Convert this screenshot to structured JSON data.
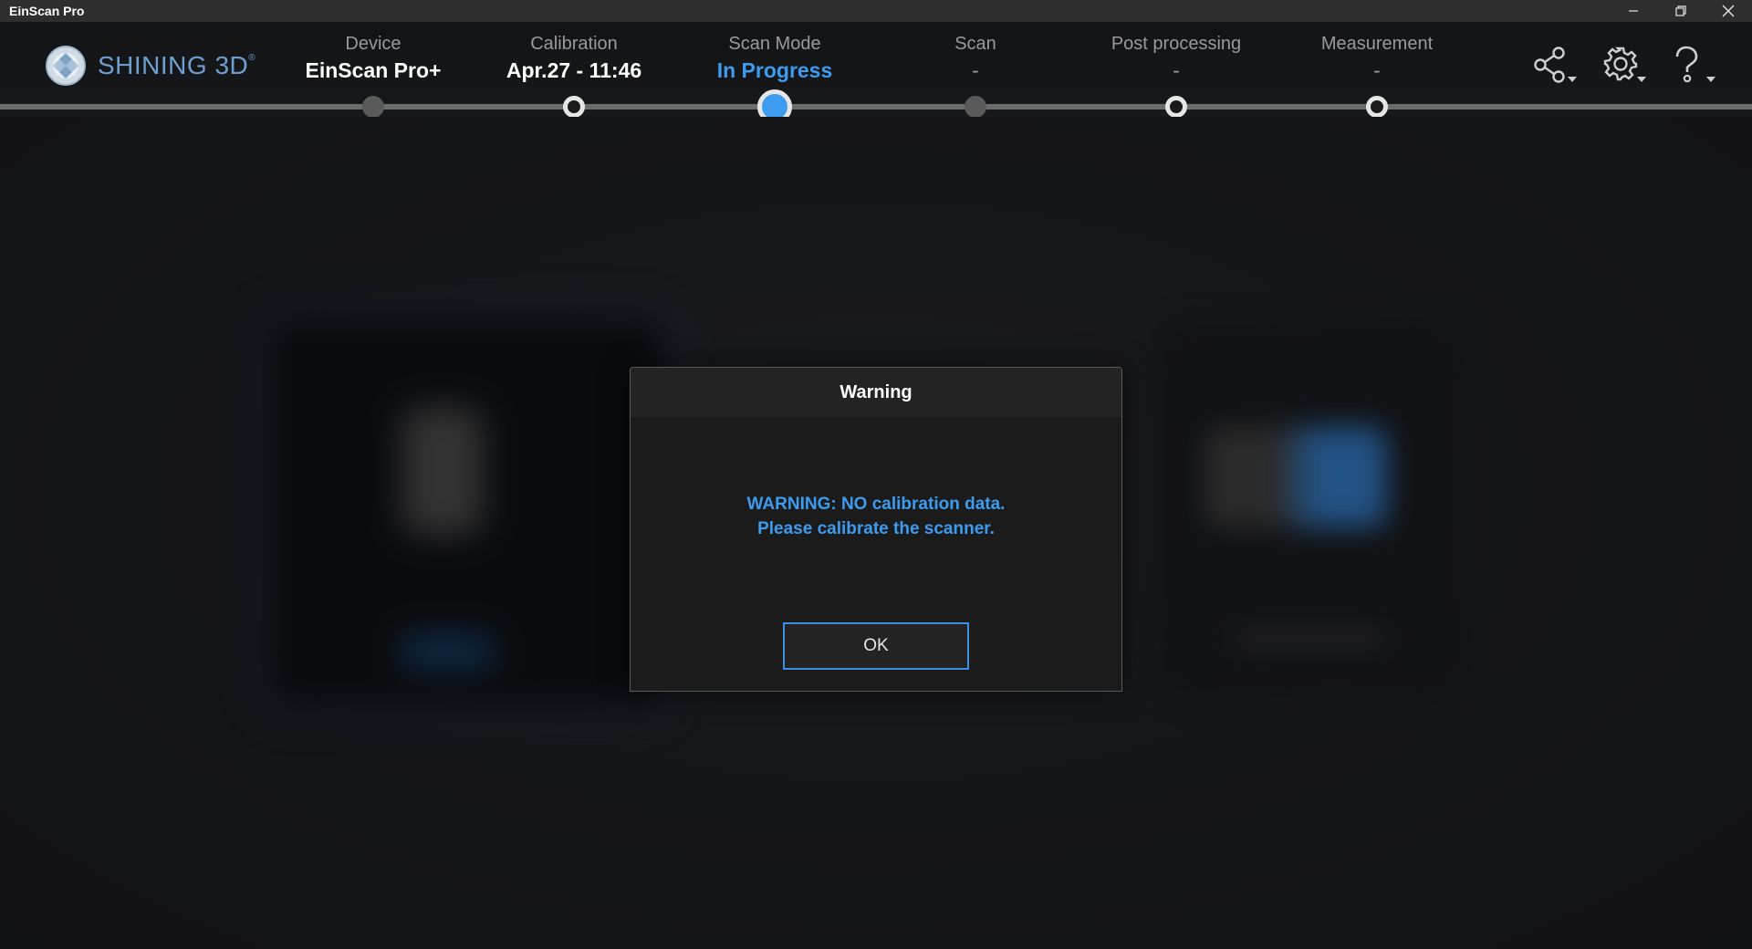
{
  "window": {
    "title": "EinScan Pro",
    "controls": [
      "minimize-icon",
      "restore-icon",
      "close-icon"
    ]
  },
  "brand": {
    "name": "SHINING 3D",
    "mark": "®",
    "logo_icon": "globe-logo-icon"
  },
  "steps": [
    {
      "label": "Device",
      "value": "EinScan Pro+",
      "state": "done"
    },
    {
      "label": "Calibration",
      "value": "Apr.27 - 11:46",
      "state": "done"
    },
    {
      "label": "Scan Mode",
      "value": "In Progress",
      "state": "current"
    },
    {
      "label": "Scan",
      "value": "-",
      "state": "pending"
    },
    {
      "label": "Post processing",
      "value": "-",
      "state": "pending"
    },
    {
      "label": "Measurement",
      "value": "-",
      "state": "pending"
    }
  ],
  "header_icons": [
    "share-icon",
    "gear-icon",
    "help-icon"
  ],
  "dialog": {
    "title": "Warning",
    "message_line1": "WARNING: NO calibration data.",
    "message_line2": "Please calibrate the scanner.",
    "ok_label": "OK"
  },
  "colors": {
    "accent": "#3d9bf0",
    "background": "#1a1b1e",
    "titlebar": "#2e2e2e",
    "brand": "#6f9fd0"
  }
}
